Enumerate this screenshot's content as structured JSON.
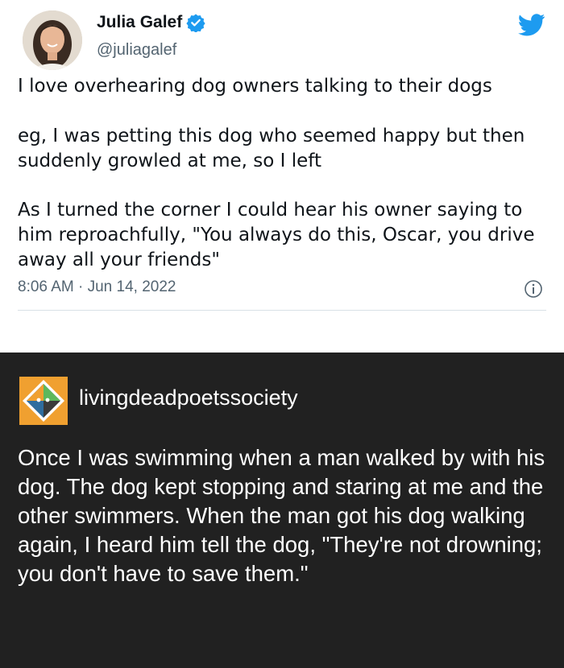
{
  "tweet": {
    "display_name": "Julia Galef",
    "handle": "@juliagalef",
    "verified": true,
    "paragraphs": [
      "I love overhearing dog owners talking to their dogs",
      "eg, I was petting this dog who seemed happy but then suddenly growled at me, so I left",
      "As I turned the corner I could hear his owner saying to him reproachfully, \"You always do this, Oscar, you drive away all your friends\""
    ],
    "timestamp": "8:06 AM · Jun 14, 2022",
    "icons": {
      "brand": "twitter-bird-icon",
      "verified": "verified-badge-icon",
      "info": "info-icon"
    },
    "colors": {
      "brand_blue": "#1d9bf0",
      "text": "#0f1419",
      "secondary": "#536471"
    }
  },
  "post": {
    "author": "livingdeadpoetssociety",
    "body": "Once I was swimming when a man walked by with his dog. The dog kept stopping and staring at me and the other swimmers. When the man got his dog walking again, I heard him tell the dog, \"They're not drowning; you don't have to save them.\"",
    "colors": {
      "background": "#212121",
      "text": "#ffffff",
      "avatar_orange": "#f0a030",
      "avatar_blue": "#2f6d9e",
      "avatar_green": "#5cb85c"
    }
  }
}
